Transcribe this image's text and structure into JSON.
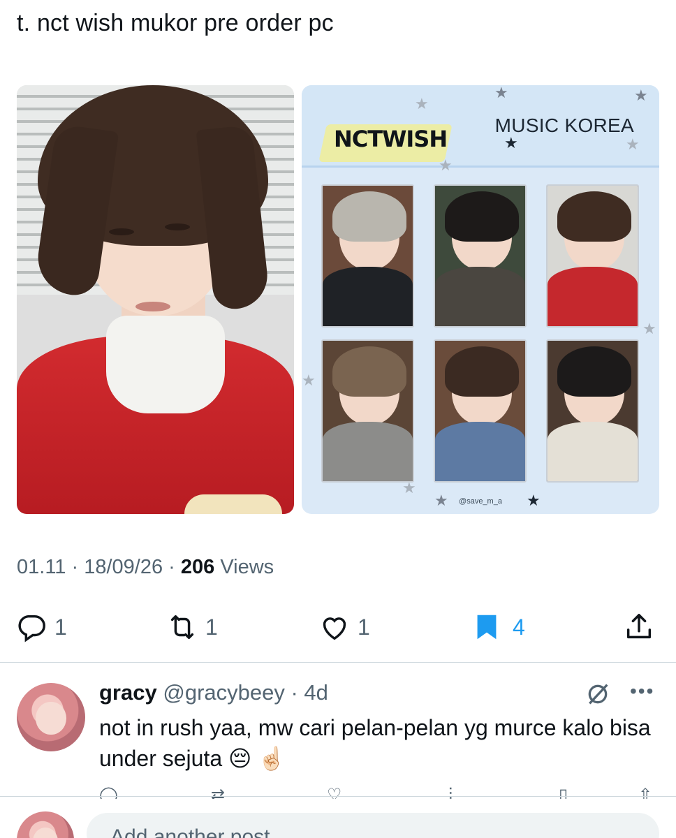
{
  "post": {
    "text": "t. nct wish mukor pre order pc",
    "time": "01.11",
    "date": "18/09/26",
    "views_count": "206",
    "views_label": "Views"
  },
  "media": {
    "right_image": {
      "logo": "NCTWISH",
      "title": "MUSIC KOREA",
      "watermark": "@save_m_a"
    }
  },
  "actions": {
    "replies": "1",
    "reposts": "1",
    "likes": "1",
    "bookmarks": "4"
  },
  "reply": {
    "display_name": "gracy",
    "handle": "@gracybeey",
    "age": "4d",
    "text": "not in rush yaa, mw cari pelan-pelan yg murce kalo bisa under sejuta 😔 ☝🏻",
    "more": "•••"
  },
  "composer": {
    "placeholder": "Add another post"
  },
  "colors": {
    "accent": "#1d9bf0",
    "muted": "#536471",
    "text": "#0f1419"
  }
}
